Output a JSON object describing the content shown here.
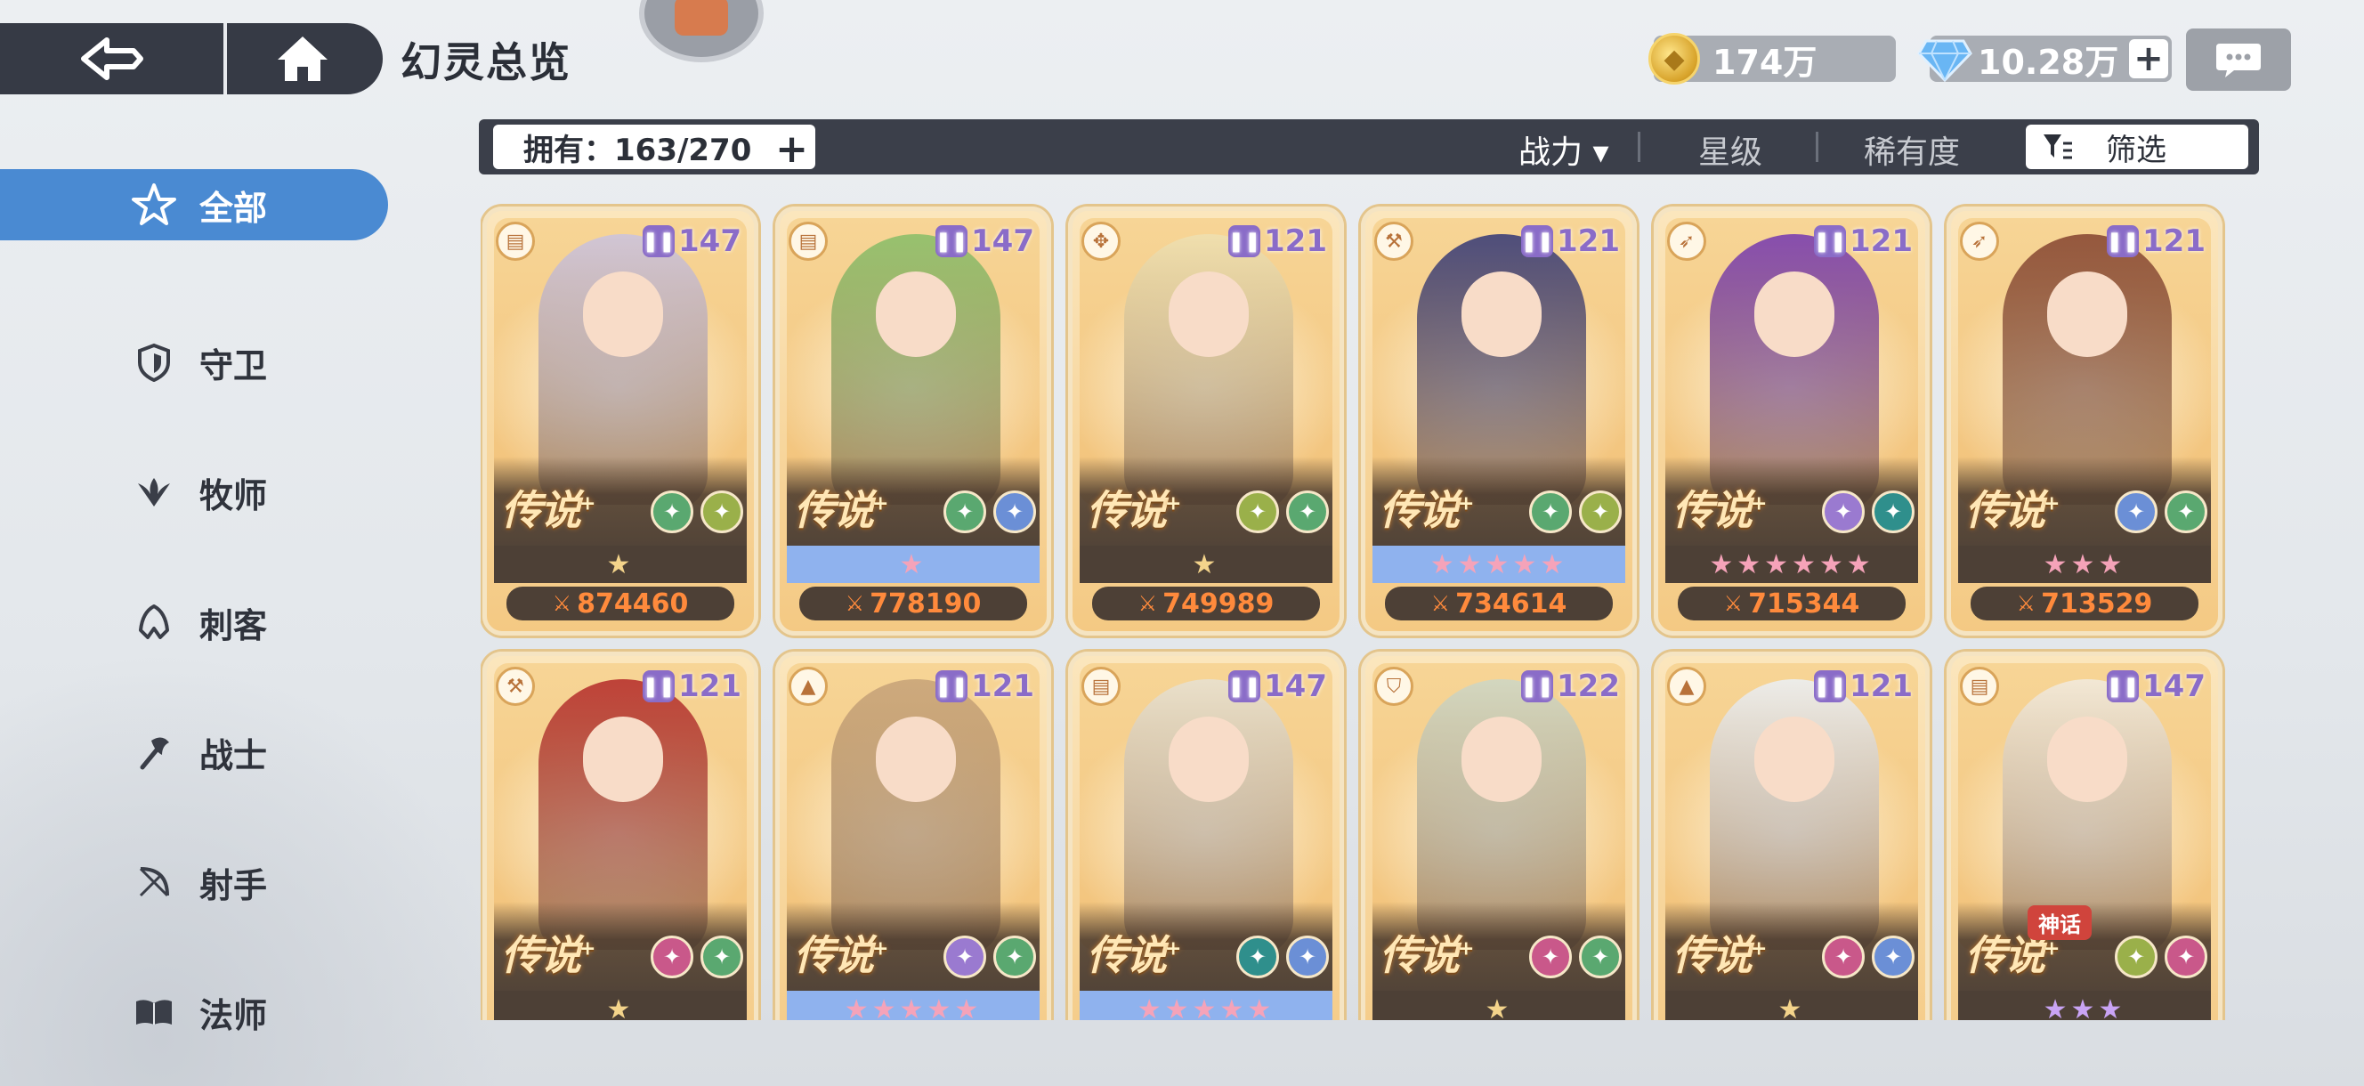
{
  "header": {
    "title": "幻灵总览",
    "gold": "174万",
    "gems": "10.28万",
    "gem_plus": "+",
    "colors": {
      "nav_bg": "#363a45",
      "active_blue": "#4a8ad2",
      "power_orange": "#ff8a3c"
    }
  },
  "sidebar": {
    "items": [
      {
        "label": "全部",
        "icon": "all-classes-icon",
        "active": true
      },
      {
        "label": "守卫",
        "icon": "shield-icon"
      },
      {
        "label": "牧师",
        "icon": "priest-wings-icon"
      },
      {
        "label": "刺客",
        "icon": "assassin-hood-icon"
      },
      {
        "label": "战士",
        "icon": "axe-icon"
      },
      {
        "label": "射手",
        "icon": "bow-icon"
      },
      {
        "label": "法师",
        "icon": "book-icon"
      }
    ]
  },
  "filterbar": {
    "owned": "拥有：163/270",
    "owned_plus": "+",
    "sort_power": "战力 ▾",
    "sort_star": "星级",
    "sort_rarity": "稀有度",
    "filter": "筛选"
  },
  "cards": [
    {
      "class_icon": "book-icon",
      "level": "147",
      "rarity": "传说",
      "stars": "gold",
      "star_text": "★",
      "power": "874460",
      "elements": [
        "#5aa870",
        "#9ab04a"
      ],
      "figure": "#cdc4dc"
    },
    {
      "class_icon": "book-icon",
      "level": "147",
      "rarity": "传说",
      "stars": "blue",
      "star_text": "★",
      "power": "778190",
      "elements": [
        "#5aa870",
        "#6b8fd6"
      ],
      "figure": "#8dbf6a"
    },
    {
      "class_icon": "priest-wings-icon",
      "level": "121",
      "rarity": "传说",
      "stars": "gold",
      "star_text": "★",
      "power": "749989",
      "elements": [
        "#9ab04a",
        "#5aa870"
      ],
      "figure": "#efe0b0"
    },
    {
      "class_icon": "axe-icon",
      "level": "121",
      "rarity": "传说",
      "stars": "blue",
      "star_text": "★★★★★",
      "power": "734614",
      "elements": [
        "#5aa870",
        "#9ab04a"
      ],
      "figure": "#3c3f78"
    },
    {
      "class_icon": "bow-icon",
      "level": "121",
      "rarity": "传说",
      "stars": "dark",
      "star_text": "★★★★★★",
      "power": "715344",
      "elements": [
        "#9a7ad0",
        "#2f8f8c"
      ],
      "figure": "#7b3fb0"
    },
    {
      "class_icon": "bow-icon",
      "level": "121",
      "rarity": "传说",
      "stars": "dark",
      "star_text": "★★★",
      "power": "713529",
      "elements": [
        "#6b8fd6",
        "#5aa870"
      ],
      "figure": "#8a4a34"
    },
    {
      "class_icon": "axe-icon",
      "level": "121",
      "rarity": "传说",
      "stars": "gold",
      "star_text": "★",
      "power": "",
      "elements": [
        "#c9588a",
        "#5aa870"
      ],
      "figure": "#b8322e"
    },
    {
      "class_icon": "assassin-hood-icon",
      "level": "121",
      "rarity": "传说",
      "stars": "blue",
      "star_text": "★★★★★",
      "power": "",
      "elements": [
        "#9a7ad0",
        "#5aa870"
      ],
      "figure": "#c9a57a"
    },
    {
      "class_icon": "book-icon",
      "level": "147",
      "rarity": "传说",
      "stars": "blue",
      "star_text": "★★★★★",
      "power": "",
      "elements": [
        "#2f8f8c",
        "#6b8fd6"
      ],
      "figure": "#e8e1d0"
    },
    {
      "class_icon": "shield-icon",
      "level": "122",
      "rarity": "传说",
      "stars": "gold",
      "star_text": "★",
      "power": "",
      "elements": [
        "#c9588a",
        "#5aa870"
      ],
      "figure": "#cfd7c4"
    },
    {
      "class_icon": "assassin-hood-icon",
      "level": "121",
      "rarity": "传说",
      "stars": "gold",
      "star_text": "★",
      "power": "",
      "elements": [
        "#c9588a",
        "#6b8fd6"
      ],
      "figure": "#eceff2"
    },
    {
      "class_icon": "book-icon",
      "level": "147",
      "rarity": "传说",
      "stars": "purple",
      "star_text": "★★★",
      "power": "",
      "elements": [
        "#9ab04a",
        "#c9588a"
      ],
      "figure": "#f2eadc",
      "myth": "神话"
    }
  ]
}
